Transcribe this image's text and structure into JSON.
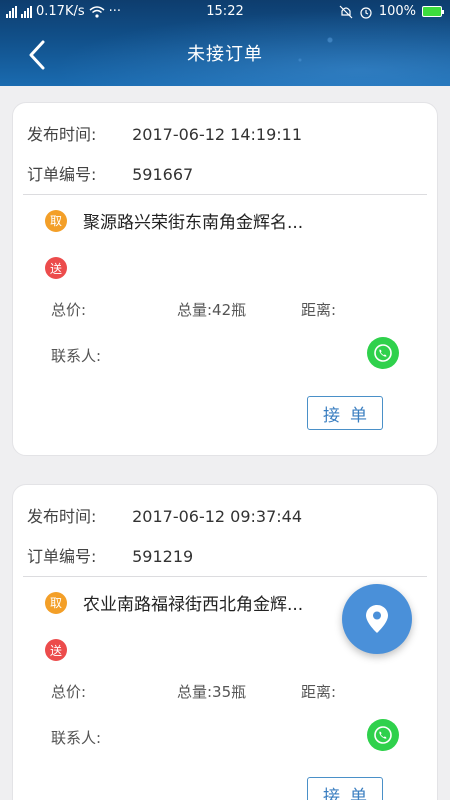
{
  "status_bar": {
    "network_speed": "0.17K/s",
    "more": "···",
    "time": "15:22",
    "battery": "100%"
  },
  "header": {
    "title": "未接订单"
  },
  "labels": {
    "publish_time": "发布时间:",
    "order_no": "订单编号:",
    "take_badge": "取",
    "send_badge": "送",
    "total_price": "总价:",
    "distance": "距离:",
    "contact": "联系人:",
    "accept_button": "接单"
  },
  "orders": [
    {
      "publish_time": "2017-06-12 14:19:11",
      "order_no": "591667",
      "pickup_address": "聚源路兴荣街东南角金辉名...",
      "delivery_address": "",
      "total_quantity": "总量:42瓶"
    },
    {
      "publish_time": "2017-06-12 09:37:44",
      "order_no": "591219",
      "pickup_address": "农业南路福禄街西北角金辉...",
      "delivery_address": "",
      "total_quantity": "总量:35瓶"
    }
  ],
  "colors": {
    "header": "#11508a",
    "take_badge": "#f39f28",
    "send_badge": "#ec4c4c",
    "accept_border": "#4a90c8",
    "fab": "#4a90d9",
    "whatsapp": "#2fd14c"
  },
  "icons": [
    "back-icon",
    "whatsapp-icon",
    "location-pin-icon",
    "wifi-icon",
    "alarm-icon",
    "mute-icon",
    "battery-icon"
  ]
}
